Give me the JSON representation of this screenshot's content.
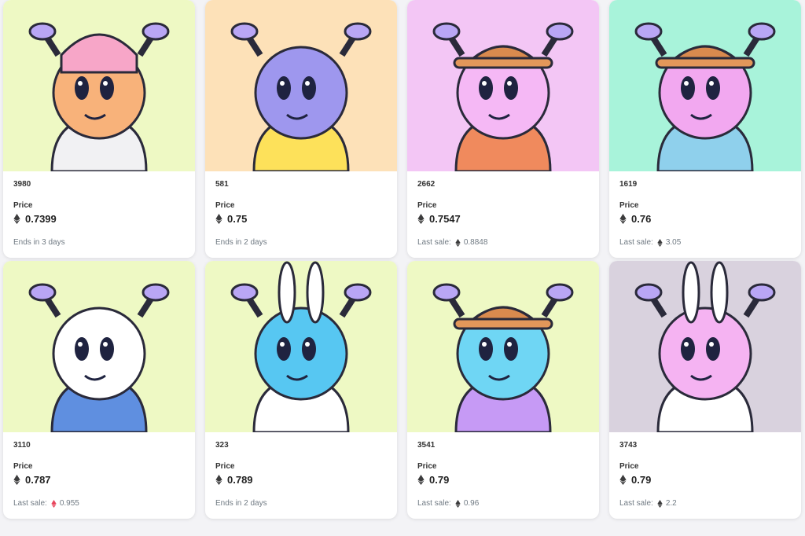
{
  "colors": {
    "card_bg": "#ffffff",
    "page_bg": "#f3f3f6",
    "eth_dark": "#3c3c3d",
    "eth_red": "#e8455c",
    "muted_text": "#707a83"
  },
  "cards": [
    {
      "token_id": "3980",
      "price_label": "Price",
      "price": "0.7399",
      "footer_text": "Ends in 3 days",
      "footer_value": "",
      "bg": "#eef9c4",
      "head": "#f8b27a",
      "body": "#f1f1f3",
      "footer_eth": "none"
    },
    {
      "token_id": "581",
      "price_label": "Price",
      "price": "0.75",
      "footer_text": "Ends in 2 days",
      "footer_value": "",
      "bg": "#fde1b8",
      "head": "#9e97ee",
      "body": "#fde15a",
      "footer_eth": "none"
    },
    {
      "token_id": "2662",
      "price_label": "Price",
      "price": "0.7547",
      "footer_text": "Last sale:",
      "footer_value": "0.8848",
      "bg": "#f3c6f5",
      "head": "#f5b8f5",
      "body": "#f08a5d",
      "footer_eth": "dark"
    },
    {
      "token_id": "1619",
      "price_label": "Price",
      "price": "0.76",
      "footer_text": "Last sale:",
      "footer_value": "3.05",
      "bg": "#a8f3da",
      "head": "#f2a8f0",
      "body": "#8fd0ec",
      "footer_eth": "dark"
    },
    {
      "token_id": "3110",
      "price_label": "Price",
      "price": "0.787",
      "footer_text": "Last sale:",
      "footer_value": "0.955",
      "bg": "#eef9c4",
      "head": "#ffffff",
      "body": "#5f8fe0",
      "footer_eth": "red"
    },
    {
      "token_id": "323",
      "price_label": "Price",
      "price": "0.789",
      "footer_text": "Ends in 2 days",
      "footer_value": "",
      "bg": "#eef9c4",
      "head": "#57c7f2",
      "body": "#ffffff",
      "footer_eth": "none"
    },
    {
      "token_id": "3541",
      "price_label": "Price",
      "price": "0.79",
      "footer_text": "Last sale:",
      "footer_value": "0.96",
      "bg": "#eef9c4",
      "head": "#6fd6f4",
      "body": "#c69af5",
      "footer_eth": "dark"
    },
    {
      "token_id": "3743",
      "price_label": "Price",
      "price": "0.79",
      "footer_text": "Last sale:",
      "footer_value": "2.2",
      "bg": "#d9d2de",
      "head": "#f5b3f2",
      "body": "#ffffff",
      "footer_eth": "dark"
    }
  ]
}
